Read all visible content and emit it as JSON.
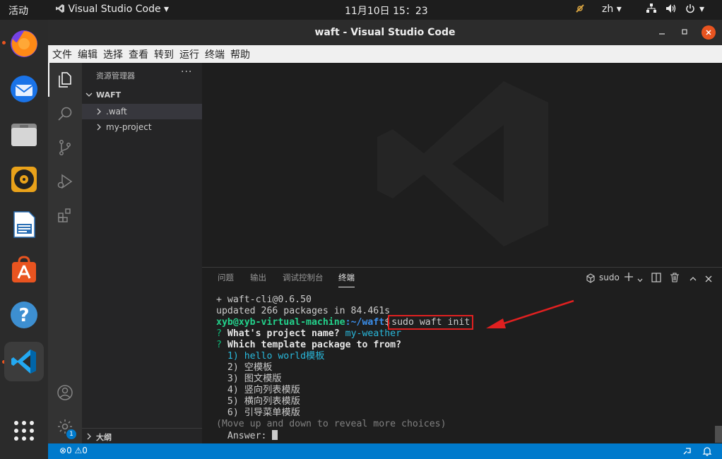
{
  "topbar": {
    "activities": "活动",
    "app_menu": "Visual Studio Code",
    "datetime": "11月10日  15：23",
    "lang": "zh"
  },
  "window": {
    "title": "waft - Visual Studio Code"
  },
  "menu": [
    "文件",
    "编辑",
    "选择",
    "查看",
    "转到",
    "运行",
    "终端",
    "帮助"
  ],
  "sidebar": {
    "title": "资源管理器",
    "folder": "WAFT",
    "items": [
      ".waft",
      "my-project"
    ],
    "outline": "大纲"
  },
  "panel": {
    "tabs": [
      "问题",
      "输出",
      "调试控制台",
      "终端"
    ],
    "shell": "sudo"
  },
  "terminal": {
    "lines": [
      "+ waft-cli@0.6.50",
      "updated 266 packages in 84.461s"
    ],
    "prompt_user": "xyb@xyb-virtual-machine",
    "prompt_path": ":~/waft",
    "prompt_symbol": "$",
    "command": "sudo waft init",
    "q1_mark": "?",
    "q1": " What's project name? ",
    "q1_answer": "my-weather",
    "q2_mark": "?",
    "q2": " Which template package to from?",
    "options": [
      "  1) hello world模板",
      "  2) 空模板",
      "  3) 图文模版",
      "  4) 竖向列表模版",
      "  5) 横向列表模版",
      "  6) 引导菜单模版"
    ],
    "hint": "(Move up and down to reveal more choices)",
    "answer_label": "  Answer: "
  },
  "status": {
    "errors": "0",
    "warnings": "0",
    "badge": "1"
  },
  "colors": {
    "accent": "#007acc",
    "annotation": "#e02020",
    "prompt_green": "#23d18b",
    "prompt_blue": "#3b8eea",
    "question": "#0dbc79"
  }
}
